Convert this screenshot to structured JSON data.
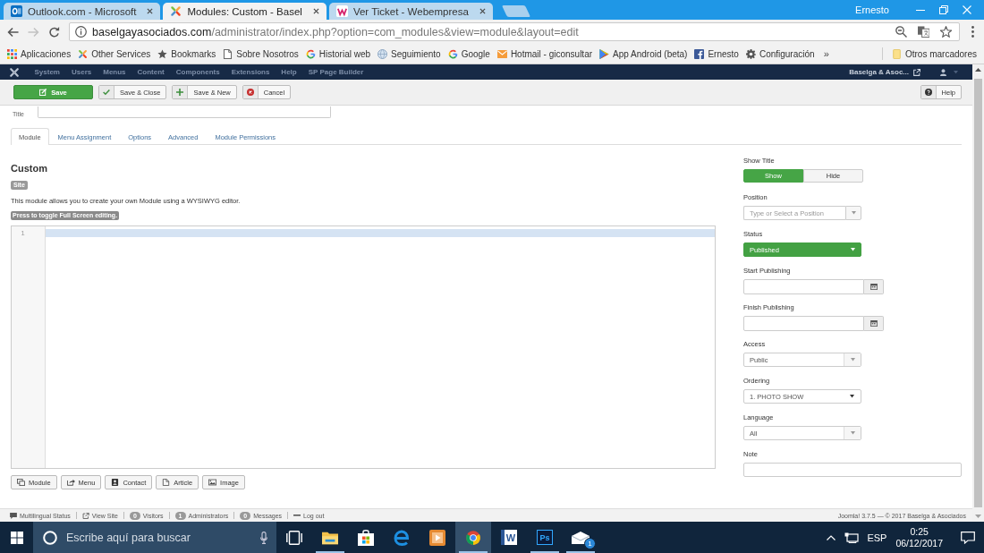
{
  "browser": {
    "tabs": [
      {
        "title": "Outlook.com - Microsoft",
        "kind": "outlook",
        "selected": false
      },
      {
        "title": "Modules: Custom - Basel",
        "kind": "joomla",
        "selected": true
      },
      {
        "title": "Ver Ticket - Webempresa",
        "kind": "webempresa",
        "selected": false
      }
    ],
    "profile": "Ernesto",
    "address": {
      "host": "baselgayasociados.com",
      "path": "/administrator/index.php?option=com_modules&view=module&layout=edit"
    },
    "bookmarks": [
      {
        "label": "Aplicaciones",
        "kind": "apps"
      },
      {
        "label": "Other Services",
        "kind": "joomla"
      },
      {
        "label": "Bookmarks",
        "kind": "star"
      },
      {
        "label": "Sobre Nosotros",
        "kind": "page"
      },
      {
        "label": "Historial web",
        "kind": "google"
      },
      {
        "label": "Seguimiento",
        "kind": "globe"
      },
      {
        "label": "Google",
        "kind": "google"
      },
      {
        "label": "Hotmail - giconsultar",
        "kind": "mail"
      },
      {
        "label": "App Android (beta)",
        "kind": "play"
      },
      {
        "label": "Ernesto",
        "kind": "facebook"
      },
      {
        "label": "Configuración",
        "kind": "gear"
      }
    ],
    "overflow": "»",
    "other_bookmarks": "Otros marcadores"
  },
  "admin_menu": {
    "items": [
      "System",
      "Users",
      "Menus",
      "Content",
      "Components",
      "Extensions",
      "Help",
      "SP Page Builder"
    ],
    "site_link": "Baselga & Asoc..."
  },
  "toolbar": {
    "buttons": [
      {
        "label": "Save",
        "kind": "save"
      },
      {
        "label": "Save & Close",
        "kind": "save-close"
      },
      {
        "label": "Save & New",
        "kind": "save-new"
      },
      {
        "label": "Cancel",
        "kind": "cancel"
      }
    ],
    "help": "Help"
  },
  "title_field": {
    "label": "Title"
  },
  "tabs": [
    {
      "label": "Module",
      "selected": true
    },
    {
      "label": "Menu Assignment",
      "selected": false
    },
    {
      "label": "Options",
      "selected": false
    },
    {
      "label": "Advanced",
      "selected": false
    },
    {
      "label": "Module Permissions",
      "selected": false
    }
  ],
  "module": {
    "heading": "Custom",
    "client_badge": "Site",
    "description": "This module allows you to create your own Module using a WYSIWYG editor.",
    "fullscreen_hint": "Press to toggle Full Screen editing.",
    "editor": {
      "line_numbers": [
        "1"
      ]
    },
    "editor_buttons": [
      {
        "label": "Module",
        "kind": "module"
      },
      {
        "label": "Menu",
        "kind": "menu"
      },
      {
        "label": "Contact",
        "kind": "contact"
      },
      {
        "label": "Article",
        "kind": "article"
      },
      {
        "label": "Image",
        "kind": "image"
      }
    ]
  },
  "settings": [
    {
      "label": "Show Title",
      "kind": "toggle",
      "options": [
        {
          "label": "Show",
          "selected": true
        },
        {
          "label": "Hide",
          "selected": false
        }
      ]
    },
    {
      "label": "Position",
      "kind": "combo",
      "placeholder": "Type or Select a Position"
    },
    {
      "label": "Status",
      "kind": "status",
      "value": "Published"
    },
    {
      "label": "Start Publishing",
      "kind": "date"
    },
    {
      "label": "Finish Publishing",
      "kind": "date"
    },
    {
      "label": "Access",
      "kind": "select",
      "value": "Public"
    },
    {
      "label": "Ordering",
      "kind": "native-select",
      "value": "1. PHOTO SHOW"
    },
    {
      "label": "Language",
      "kind": "select",
      "value": "All"
    },
    {
      "label": "Note",
      "kind": "text"
    }
  ],
  "status_bar": {
    "items": [
      {
        "label": "Multilingual Status",
        "kind": "comment"
      },
      {
        "label": "View Site",
        "kind": "external"
      },
      {
        "label": "Visitors",
        "kind": "count",
        "count": "0"
      },
      {
        "label": "Administrators",
        "kind": "count",
        "count": "1"
      },
      {
        "label": "Messages",
        "kind": "count",
        "count": "0"
      },
      {
        "label": "Log out",
        "kind": "minus"
      }
    ],
    "footer": "Joomla! 3.7.5 — © 2017 Baselga & Asociados"
  },
  "taskbar": {
    "search_placeholder": "Escribe aquí para buscar",
    "apps": [
      {
        "kind": "task-view",
        "running": false,
        "selected": false
      },
      {
        "kind": "explorer",
        "running": true,
        "selected": false
      },
      {
        "kind": "store",
        "running": false,
        "selected": false
      },
      {
        "kind": "edge",
        "running": false,
        "selected": false
      },
      {
        "kind": "media",
        "running": false,
        "selected": false
      },
      {
        "kind": "chrome",
        "running": true,
        "selected": true
      },
      {
        "kind": "word",
        "glyph": "W",
        "running": false,
        "selected": false
      },
      {
        "kind": "photoshop",
        "glyph": "Ps",
        "running": true,
        "selected": false
      },
      {
        "kind": "mail",
        "badge": "1",
        "running": true,
        "selected": false
      }
    ],
    "language": "ESP",
    "time": "0:25",
    "date": "06/12/2017"
  }
}
